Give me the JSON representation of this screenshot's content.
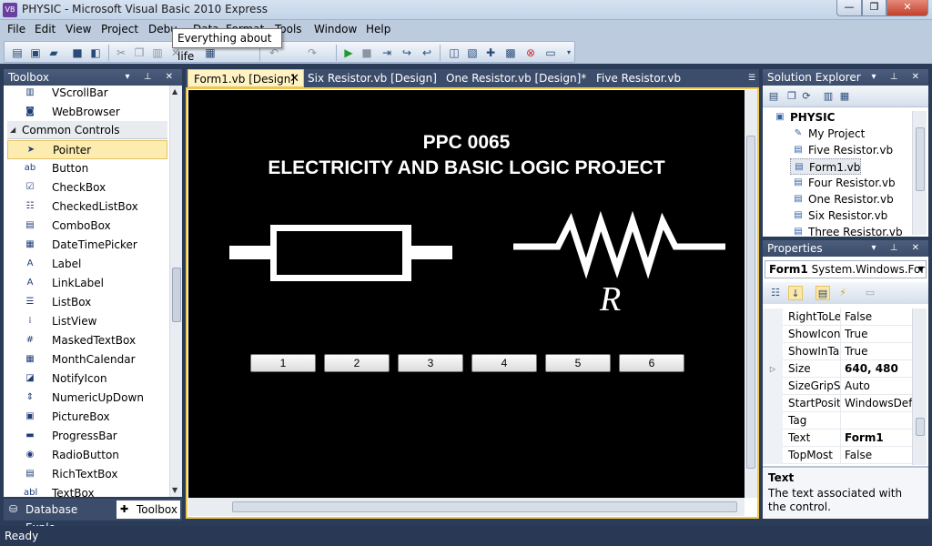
{
  "window": {
    "title": "PHYSIC - Microsoft Visual Basic 2010 Express",
    "app_icon": "VB",
    "min": "—",
    "max": "❐",
    "close": "✕"
  },
  "menu": [
    "File",
    "Edit",
    "View",
    "Project",
    "Debu",
    "Data",
    "Format",
    "Tools",
    "Window",
    "Help"
  ],
  "tooltip": "Everything about life",
  "toolbox": {
    "title": "Toolbox",
    "section": "Common Controls",
    "items_top": [
      {
        "label": "VScrollBar",
        "icon": "vscrollbar-icon",
        "glyph": "▥"
      },
      {
        "label": "WebBrowser",
        "icon": "webbrowser-icon",
        "glyph": "◙"
      }
    ],
    "items": [
      {
        "label": "Pointer",
        "icon": "pointer-icon",
        "glyph": "➤"
      },
      {
        "label": "Button",
        "icon": "button-icon",
        "glyph": "ab"
      },
      {
        "label": "CheckBox",
        "icon": "checkbox-icon",
        "glyph": "☑"
      },
      {
        "label": "CheckedListBox",
        "icon": "checkedlistbox-icon",
        "glyph": "☷"
      },
      {
        "label": "ComboBox",
        "icon": "combobox-icon",
        "glyph": "▤"
      },
      {
        "label": "DateTimePicker",
        "icon": "datetimepicker-icon",
        "glyph": "▦"
      },
      {
        "label": "Label",
        "icon": "label-icon",
        "glyph": "A"
      },
      {
        "label": "LinkLabel",
        "icon": "linklabel-icon",
        "glyph": "A"
      },
      {
        "label": "ListBox",
        "icon": "listbox-icon",
        "glyph": "☰"
      },
      {
        "label": "ListView",
        "icon": "listview-icon",
        "glyph": "⁞"
      },
      {
        "label": "MaskedTextBox",
        "icon": "maskedtextbox-icon",
        "glyph": "#"
      },
      {
        "label": "MonthCalendar",
        "icon": "monthcalendar-icon",
        "glyph": "▦"
      },
      {
        "label": "NotifyIcon",
        "icon": "notifyicon-icon",
        "glyph": "◪"
      },
      {
        "label": "NumericUpDown",
        "icon": "numericupdown-icon",
        "glyph": "⇕"
      },
      {
        "label": "PictureBox",
        "icon": "picturebox-icon",
        "glyph": "▣"
      },
      {
        "label": "ProgressBar",
        "icon": "progressbar-icon",
        "glyph": "▬"
      },
      {
        "label": "RadioButton",
        "icon": "radiobutton-icon",
        "glyph": "◉"
      },
      {
        "label": "RichTextBox",
        "icon": "richtextbox-icon",
        "glyph": "▤"
      },
      {
        "label": "TextBox",
        "icon": "textbox-icon",
        "glyph": "abl"
      }
    ],
    "bottom_tabs": [
      "Database Explo...",
      "Toolbox"
    ]
  },
  "doc_tabs": [
    "Form1.vb [Design]",
    "Six Resistor.vb [Design]",
    "One Resistor.vb [Design]*",
    "Five Resistor.vb"
  ],
  "form": {
    "title_line1": "PPC 0065",
    "title_line2": "ELECTRICITY AND BASIC LOGIC PROJECT",
    "resistor_symbol_label": "R",
    "buttons": [
      "1",
      "2",
      "3",
      "4",
      "5",
      "6"
    ]
  },
  "solution_explorer": {
    "title": "Solution Explorer",
    "project": "PHYSIC",
    "items": [
      "My Project",
      "Five Resistor.vb",
      "Form1.vb",
      "Four Resistor.vb",
      "One Resistor.vb",
      "Six Resistor.vb",
      "Three Resistor.vb"
    ]
  },
  "properties": {
    "title": "Properties",
    "object_name": "Form1",
    "object_type": "System.Windows.Forms.Form",
    "rows": [
      {
        "name": "RightToLef",
        "value": "False",
        "bold": false,
        "expand": false
      },
      {
        "name": "ShowIcon",
        "value": "True",
        "bold": false,
        "expand": false
      },
      {
        "name": "ShowInTas",
        "value": "True",
        "bold": false,
        "expand": false
      },
      {
        "name": "Size",
        "value": "640, 480",
        "bold": true,
        "expand": true
      },
      {
        "name": "SizeGripSty",
        "value": "Auto",
        "bold": false,
        "expand": false
      },
      {
        "name": "StartPositic",
        "value": "WindowsDefa",
        "bold": false,
        "expand": false
      },
      {
        "name": "Tag",
        "value": "",
        "bold": false,
        "expand": false
      },
      {
        "name": "Text",
        "value": "Form1",
        "bold": true,
        "expand": false
      },
      {
        "name": "TopMost",
        "value": "False",
        "bold": false,
        "expand": false
      }
    ],
    "desc_title": "Text",
    "desc_text": "The text associated with the control."
  },
  "status": "Ready",
  "colors": {
    "accent": "#f0c94c",
    "chrome": "#2b3c59",
    "form_background": "#000000"
  }
}
